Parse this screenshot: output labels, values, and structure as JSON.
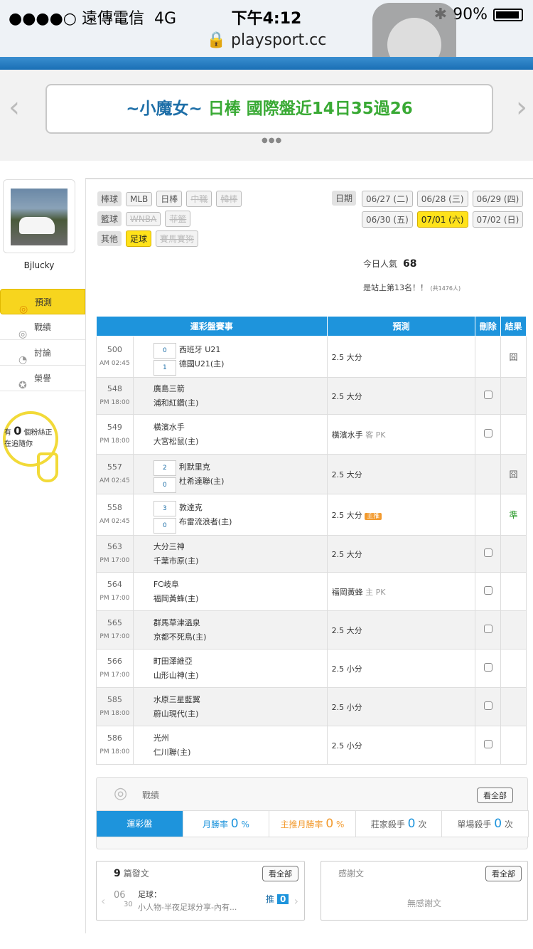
{
  "status": {
    "carrier": "●●●●○ 遠傳電信",
    "network": "4G",
    "time": "下午4:12",
    "battery": "90%",
    "url": "playsport.cc"
  },
  "banner": {
    "prefix": "~小魔女~",
    "sport": "日棒",
    "text": "國際盤近14日35過26"
  },
  "user": {
    "name": "Bjlucky"
  },
  "menu": [
    {
      "label": "預測",
      "icon": "target-icon"
    },
    {
      "label": "戰績",
      "icon": "record-icon"
    },
    {
      "label": "討論",
      "icon": "discuss-icon"
    },
    {
      "label": "榮譽",
      "icon": "medal-icon"
    }
  ],
  "fans": {
    "prefix": "有",
    "count": "0",
    "suffix": "個粉絲正",
    "line2": "在追隨你"
  },
  "categories": {
    "baseball": {
      "label": "棒球",
      "items": [
        "MLB",
        "日棒",
        "中職",
        "韓棒"
      ]
    },
    "basketball": {
      "label": "籃球",
      "items": [
        "WNBA",
        "菲籃"
      ]
    },
    "other": {
      "label": "其他",
      "items": [
        "足球",
        "賽馬賽狗"
      ]
    }
  },
  "dates": {
    "label": "日期",
    "items": [
      "06/27 (二)",
      "06/28 (三)",
      "06/29 (四)",
      "06/30 (五)",
      "07/01 (六)",
      "07/02 (日)"
    ]
  },
  "popularity": {
    "label": "今日人氣",
    "value": "68",
    "rank": "是站上第13名！！",
    "total": "(共1476人)"
  },
  "table": {
    "headers": [
      "運彩盤賽事",
      "預測",
      "刪除",
      "結果"
    ],
    "rows": [
      {
        "id": "500",
        "time": "AM 02:45",
        "home_score": "0",
        "away_score": "1",
        "team1": "西班牙 U21",
        "team2": "德國U21(主)",
        "pick": "2.5 大分",
        "tag": "",
        "result": "囧"
      },
      {
        "id": "548",
        "time": "PM 18:00",
        "team1": "廣島三箭",
        "team2": "浦和紅鑽(主)",
        "pick": "2.5 大分",
        "tag": "",
        "result": ""
      },
      {
        "id": "549",
        "time": "PM 18:00",
        "team1": "橫濱水手",
        "team2": "大宮松鼠(主)",
        "pick": "橫濱水手",
        "sub": "客 PK",
        "tag": "",
        "result": ""
      },
      {
        "id": "557",
        "time": "AM 02:45",
        "home_score": "2",
        "away_score": "0",
        "team1": "利默里克",
        "team2": "杜希達聯(主)",
        "pick": "2.5 大分",
        "tag": "",
        "result": "囧"
      },
      {
        "id": "558",
        "time": "AM 02:45",
        "home_score": "3",
        "away_score": "0",
        "team1": "敦達克",
        "team2": "布雷流浪者(主)",
        "pick": "2.5 大分",
        "tag": "主推",
        "result": "準"
      },
      {
        "id": "563",
        "time": "PM 17:00",
        "team1": "大分三神",
        "team2": "千葉市原(主)",
        "pick": "2.5 大分",
        "tag": "",
        "result": ""
      },
      {
        "id": "564",
        "time": "PM 17:00",
        "team1": "FC岐阜",
        "team2": "福岡黃蜂(主)",
        "pick": "福岡黃蜂",
        "sub": "主 PK",
        "tag": "",
        "result": ""
      },
      {
        "id": "565",
        "time": "PM 17:00",
        "team1": "群馬草津溫泉",
        "team2": "京都不死鳥(主)",
        "pick": "2.5 大分",
        "tag": "",
        "result": ""
      },
      {
        "id": "566",
        "time": "PM 17:00",
        "team1": "町田澤維亞",
        "team2": "山形山神(主)",
        "pick": "2.5 小分",
        "tag": "",
        "result": ""
      },
      {
        "id": "585",
        "time": "PM 18:00",
        "team1": "水原三星藍翼",
        "team2": "蔚山現代(主)",
        "pick": "2.5 小分",
        "tag": "",
        "result": ""
      },
      {
        "id": "586",
        "time": "PM 18:00",
        "team1": "光州",
        "team2": "仁川聯(主)",
        "pick": "2.5 小分",
        "tag": "",
        "result": ""
      }
    ]
  },
  "performance": {
    "title": "戰績",
    "view_all": "看全部",
    "tab": "運彩盤",
    "month_rate": "月勝率",
    "month_val": "0",
    "pct": "%",
    "main_rate": "主推月勝率",
    "main_val": "0",
    "banker": "莊家殺手",
    "banker_val": "0",
    "single": "單場殺手",
    "single_val": "0",
    "unit": "次"
  },
  "posts": {
    "count": "9",
    "label": "篇發文",
    "view_all": "看全部",
    "month": "06",
    "day": "30",
    "cat": "足球：",
    "title": "小人物-半夜足球分享-內有...",
    "push": "推",
    "push_count": "0"
  },
  "thanks": {
    "label": "感謝文",
    "view_all": "看全部",
    "empty": "無感謝文"
  }
}
